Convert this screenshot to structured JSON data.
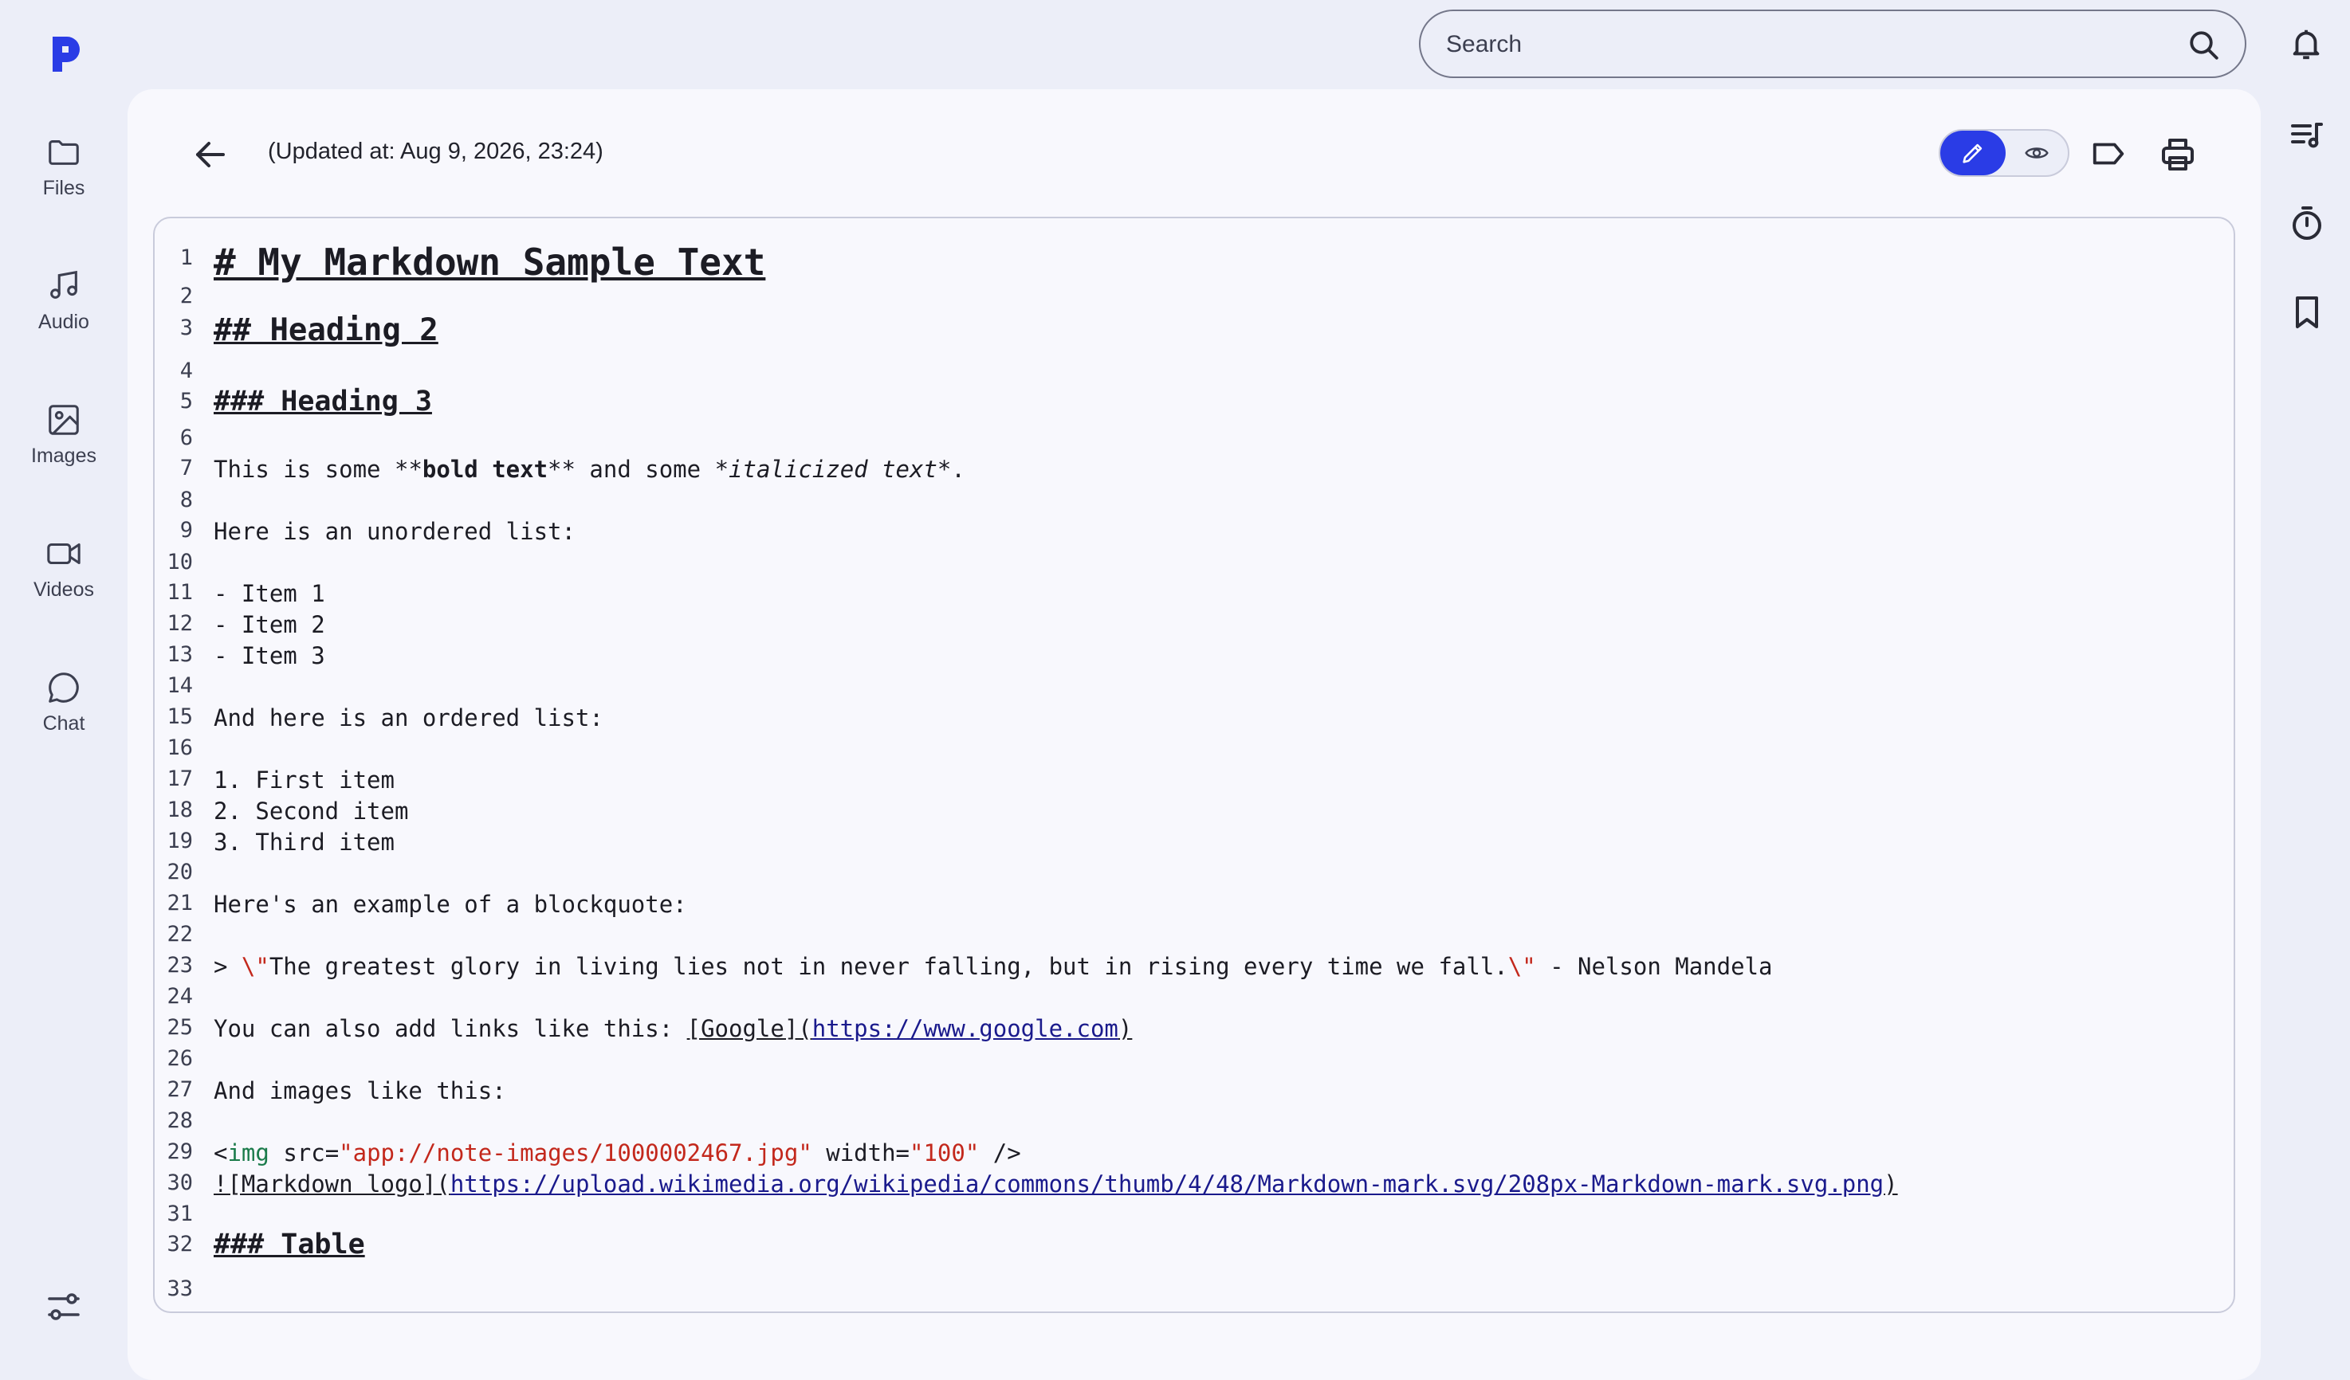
{
  "left_nav": {
    "items": [
      {
        "label": "Files",
        "icon": "folder-icon"
      },
      {
        "label": "Audio",
        "icon": "music-note-icon"
      },
      {
        "label": "Images",
        "icon": "image-icon"
      },
      {
        "label": "Videos",
        "icon": "video-camera-icon"
      },
      {
        "label": "Chat",
        "icon": "chat-bubble-icon"
      }
    ]
  },
  "search": {
    "placeholder": "Search"
  },
  "header": {
    "updated": "(Updated at: Aug 9, 2026, 23:24)"
  },
  "accent_color": "#2a3ce6",
  "editor": {
    "line_numbers": [
      "1",
      "2",
      "3",
      "4",
      "5",
      "6",
      "7",
      "8",
      "9",
      "10",
      "11",
      "12",
      "13",
      "14",
      "15",
      "16",
      "17",
      "18",
      "19",
      "20",
      "21",
      "22",
      "23",
      "24",
      "25",
      "26",
      "27",
      "28",
      "29",
      "30",
      "31",
      "32",
      "33"
    ],
    "l1": "# My Markdown Sample Text",
    "l3": "## Heading 2",
    "l5": "### Heading 3",
    "l7": {
      "a": "This is some ",
      "b": "**",
      "c": "bold text",
      "d": "**",
      "e": " and some ",
      "f": "*italicized text*",
      "g": "."
    },
    "l9": "Here is an unordered list:",
    "l11": "- Item 1",
    "l12": "- Item 2",
    "l13": "- Item 3",
    "l15": "And here is an ordered list:",
    "l17": "1. First item",
    "l18": "2. Second item",
    "l19": "3. Third item",
    "l21": "Here's an example of a blockquote:",
    "l23": {
      "a": "> ",
      "b": "\\\"",
      "c": "The greatest glory in living lies not in never falling, but in rising every time we fall.",
      "d": "\\\"",
      "e": " - Nelson Mandela"
    },
    "l25": {
      "a": "You can also add links like this: ",
      "b": "[Google](",
      "c": "https://www.google.com",
      "d": ")"
    },
    "l27": "And images like this:",
    "l29": {
      "a": "<",
      "b": "img",
      "c": " src=",
      "d": "\"app://note-images/1000002467.jpg\"",
      "e": " width=",
      "f": "\"100\"",
      "g": " />"
    },
    "l30": {
      "a": "![Markdown logo](",
      "b": "https://upload.wikimedia.org/wikipedia/commons/thumb/4/48/Markdown-mark.svg/208px-Markdown-mark.svg.png",
      "c": ")"
    },
    "l32": "### Table"
  }
}
